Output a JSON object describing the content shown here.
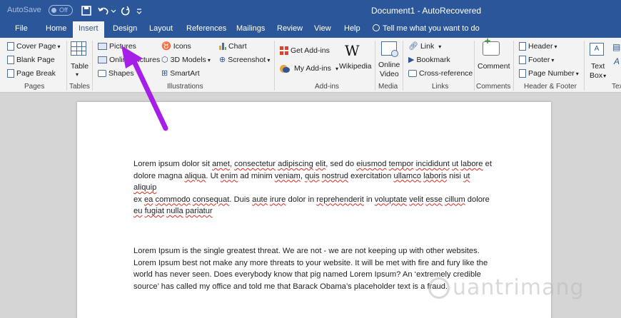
{
  "titlebar": {
    "autosave": "AutoSave",
    "autosave_state": "Off",
    "document_title": "Document1 - AutoRecovered"
  },
  "tabs": [
    "File",
    "Home",
    "Insert",
    "Design",
    "Layout",
    "References",
    "Mailings",
    "Review",
    "View",
    "Help"
  ],
  "active_tab": "Insert",
  "tell_me": "Tell me what you want to do",
  "ribbon": {
    "pages": {
      "label": "Pages",
      "cover_page": "Cover Page",
      "blank_page": "Blank Page",
      "page_break": "Page Break"
    },
    "tables": {
      "label": "Tables",
      "table": "Table"
    },
    "illustrations": {
      "label": "Illustrations",
      "pictures": "Pictures",
      "online_pictures": "Online Pictures",
      "shapes": "Shapes",
      "icons": "Icons",
      "models_3d": "3D Models",
      "smartart": "SmartArt",
      "chart": "Chart",
      "screenshot": "Screenshot"
    },
    "addins": {
      "label": "Add-ins",
      "get_addins": "Get Add-ins",
      "my_addins": "My Add-ins",
      "wikipedia": "Wikipedia"
    },
    "media": {
      "label": "Media",
      "online_video_1": "Online",
      "online_video_2": "Video"
    },
    "links": {
      "label": "Links",
      "link": "Link",
      "bookmark": "Bookmark",
      "cross_reference": "Cross-reference"
    },
    "comments": {
      "label": "Comments",
      "comment": "Comment"
    },
    "header_footer": {
      "label": "Header & Footer",
      "header": "Header",
      "footer": "Footer",
      "page_number": "Page Number"
    },
    "text": {
      "label": "Tex",
      "textbox_1": "Text",
      "textbox_2": "Box"
    }
  },
  "document": {
    "paragraph1_lines": [
      "Lorem ipsum dolor sit amet, consectetur adipiscing elit, sed do eiusmod tempor incididunt ut labore et",
      "dolore magna aliqua. Ut enim ad minim veniam, quis nostrud exercitation ullamco laboris nisi ut aliquip",
      "ex ea commodo consequat. Duis aute irure dolor in reprehenderit in voluptate velit esse cillum dolore",
      "eu fugiat nulla pariatur"
    ],
    "paragraph2_lines": [
      "Lorem Ipsum is the single greatest threat. We are not - we are not keeping up with other websites.",
      "Lorem Ipsum best not make any more threats to your website. It will be met with fire and fury like the",
      "world has never seen. Does everybody know that pig named Lorem Ipsum? An ‘extremely credible",
      "source’ has called my office and told me that Barack Obama’s placeholder text is a fraud."
    ]
  },
  "watermark": "uantrimang",
  "colors": {
    "word_blue": "#2b579a",
    "annotation_arrow": "#a61fe8"
  }
}
